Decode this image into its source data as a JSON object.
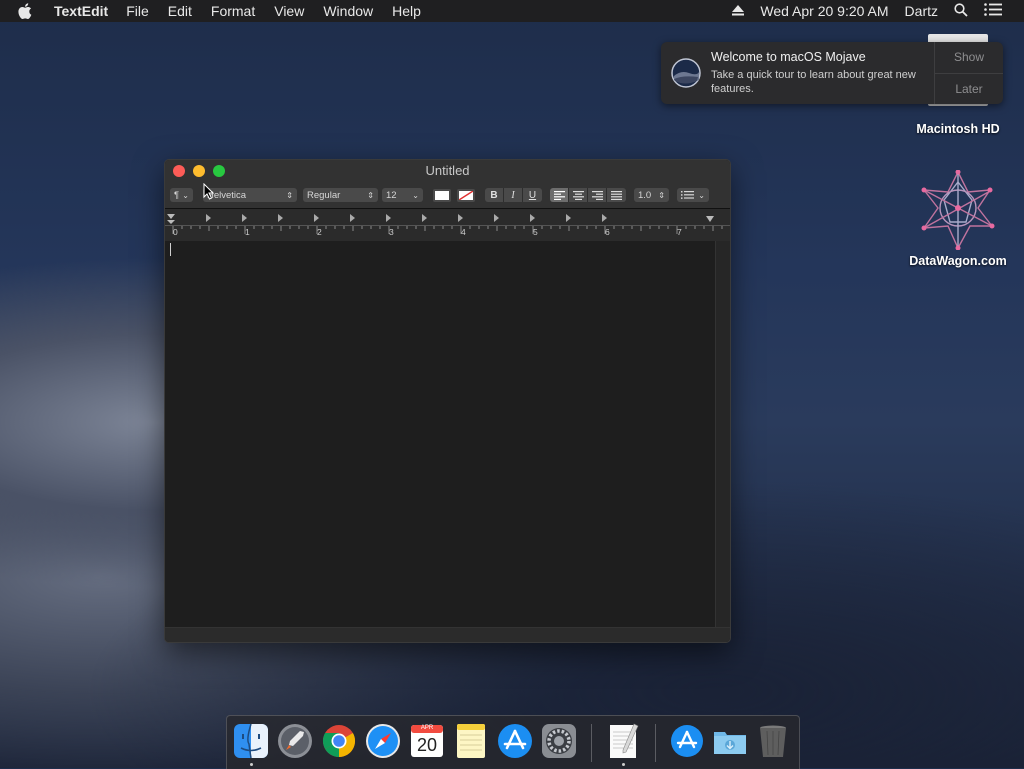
{
  "menubar": {
    "app": "TextEdit",
    "items": [
      "File",
      "Edit",
      "Format",
      "View",
      "Window",
      "Help"
    ],
    "datetime": "Wed Apr 20  9:20 AM",
    "user": "Dartz",
    "icons": [
      "apple-icon",
      "eject-icon",
      "spotlight-icon",
      "notification-center-icon"
    ]
  },
  "notification": {
    "title": "Welcome to macOS Mojave",
    "body": "Take a quick tour to learn about great new features.",
    "actions": [
      "Show",
      "Later"
    ]
  },
  "desktop": {
    "icons": [
      {
        "label": "Macintosh HD",
        "icon": "hard-drive-icon"
      },
      {
        "label": "DataWagon.com",
        "icon": "datawagon-logo-icon"
      }
    ]
  },
  "window": {
    "title": "Untitled",
    "toolbar": {
      "paragraph_style": "¶",
      "font_family": "Helvetica",
      "font_style": "Regular",
      "font_size": "12",
      "bold": "B",
      "italic": "I",
      "underline": "U",
      "line_spacing": "1.0"
    },
    "ruler_labels": [
      "0",
      "1",
      "2",
      "3",
      "4",
      "5",
      "6",
      "7"
    ]
  },
  "dock": {
    "apps": [
      {
        "name": "Finder",
        "icon": "finder-icon",
        "running": true
      },
      {
        "name": "Launchpad",
        "icon": "launchpad-icon",
        "running": false
      },
      {
        "name": "Chrome",
        "icon": "chrome-icon",
        "running": false
      },
      {
        "name": "Safari",
        "icon": "safari-icon",
        "running": false
      },
      {
        "name": "Calendar",
        "icon": "calendar-icon",
        "running": false,
        "month": "APR",
        "day": "20"
      },
      {
        "name": "Notes",
        "icon": "notes-icon",
        "running": false
      },
      {
        "name": "App Store",
        "icon": "app-store-icon",
        "running": false
      },
      {
        "name": "System Preferences",
        "icon": "system-preferences-icon",
        "running": false
      },
      {
        "name": "TextEdit",
        "icon": "textedit-icon",
        "running": true
      },
      {
        "name": "Applications",
        "icon": "applications-folder-icon",
        "running": false
      },
      {
        "name": "Downloads",
        "icon": "downloads-folder-icon",
        "running": false
      },
      {
        "name": "Trash",
        "icon": "trash-icon",
        "running": false
      }
    ]
  }
}
